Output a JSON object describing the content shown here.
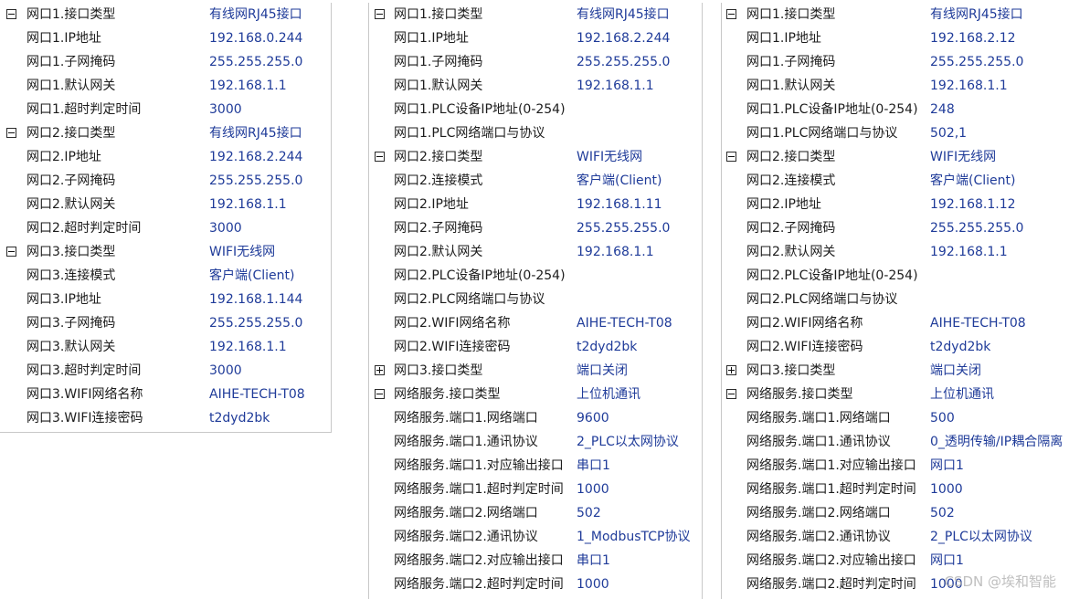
{
  "panels": [
    {
      "rows": [
        {
          "label": "网口1.接口类型",
          "value": "有线网RJ45接口",
          "toggle": "collapse"
        },
        {
          "label": "网口1.IP地址",
          "value": "192.168.0.244"
        },
        {
          "label": "网口1.子网掩码",
          "value": "255.255.255.0"
        },
        {
          "label": "网口1.默认网关",
          "value": "192.168.1.1"
        },
        {
          "label": "网口1.超时判定时间",
          "value": "3000"
        },
        {
          "label": "网口2.接口类型",
          "value": "有线网RJ45接口",
          "toggle": "collapse"
        },
        {
          "label": "网口2.IP地址",
          "value": "192.168.2.244"
        },
        {
          "label": "网口2.子网掩码",
          "value": "255.255.255.0"
        },
        {
          "label": "网口2.默认网关",
          "value": "192.168.1.1"
        },
        {
          "label": "网口2.超时判定时间",
          "value": "3000"
        },
        {
          "label": "网口3.接口类型",
          "value": "WIFI无线网",
          "toggle": "collapse"
        },
        {
          "label": "网口3.连接模式",
          "value": "客户端(Client)"
        },
        {
          "label": "网口3.IP地址",
          "value": "192.168.1.144"
        },
        {
          "label": "网口3.子网掩码",
          "value": "255.255.255.0"
        },
        {
          "label": "网口3.默认网关",
          "value": "192.168.1.1"
        },
        {
          "label": "网口3.超时判定时间",
          "value": "3000"
        },
        {
          "label": "网口3.WIFI网络名称",
          "value": "AIHE-TECH-T08"
        },
        {
          "label": "网口3.WIFI连接密码",
          "value": "t2dyd2bk"
        }
      ]
    },
    {
      "rows": [
        {
          "label": "网口1.接口类型",
          "value": "有线网RJ45接口",
          "toggle": "collapse"
        },
        {
          "label": "网口1.IP地址",
          "value": "192.168.2.244"
        },
        {
          "label": "网口1.子网掩码",
          "value": "255.255.255.0"
        },
        {
          "label": "网口1.默认网关",
          "value": "192.168.1.1"
        },
        {
          "label": "网口1.PLC设备IP地址(0-254)",
          "value": ""
        },
        {
          "label": "网口1.PLC网络端口与协议",
          "value": ""
        },
        {
          "label": "网口2.接口类型",
          "value": "WIFI无线网",
          "toggle": "collapse"
        },
        {
          "label": "网口2.连接模式",
          "value": "客户端(Client)"
        },
        {
          "label": "网口2.IP地址",
          "value": "192.168.1.11"
        },
        {
          "label": "网口2.子网掩码",
          "value": "255.255.255.0"
        },
        {
          "label": "网口2.默认网关",
          "value": "192.168.1.1"
        },
        {
          "label": "网口2.PLC设备IP地址(0-254)",
          "value": ""
        },
        {
          "label": "网口2.PLC网络端口与协议",
          "value": ""
        },
        {
          "label": "网口2.WIFI网络名称",
          "value": "AIHE-TECH-T08"
        },
        {
          "label": "网口2.WIFI连接密码",
          "value": "t2dyd2bk"
        },
        {
          "label": "网口3.接口类型",
          "value": "端口关闭",
          "toggle": "expand"
        },
        {
          "label": "网络服务.接口类型",
          "value": "上位机通讯",
          "toggle": "collapse"
        },
        {
          "label": "网络服务.端口1.网络端口",
          "value": "9600"
        },
        {
          "label": "网络服务.端口1.通讯协议",
          "value": "2_PLC以太网协议"
        },
        {
          "label": "网络服务.端口1.对应输出接口",
          "value": "串口1"
        },
        {
          "label": "网络服务.端口1.超时判定时间",
          "value": "1000"
        },
        {
          "label": "网络服务.端口2.网络端口",
          "value": "502"
        },
        {
          "label": "网络服务.端口2.通讯协议",
          "value": "1_ModbusTCP协议"
        },
        {
          "label": "网络服务.端口2.对应输出接口",
          "value": "串口1"
        },
        {
          "label": "网络服务.端口2.超时判定时间",
          "value": "1000"
        }
      ]
    },
    {
      "rows": [
        {
          "label": "网口1.接口类型",
          "value": "有线网RJ45接口",
          "toggle": "collapse"
        },
        {
          "label": "网口1.IP地址",
          "value": "192.168.2.12"
        },
        {
          "label": "网口1.子网掩码",
          "value": "255.255.255.0"
        },
        {
          "label": "网口1.默认网关",
          "value": "192.168.1.1"
        },
        {
          "label": "网口1.PLC设备IP地址(0-254)",
          "value": "248"
        },
        {
          "label": "网口1.PLC网络端口与协议",
          "value": "502,1"
        },
        {
          "label": "网口2.接口类型",
          "value": "WIFI无线网",
          "toggle": "collapse"
        },
        {
          "label": "网口2.连接模式",
          "value": "客户端(Client)"
        },
        {
          "label": "网口2.IP地址",
          "value": "192.168.1.12"
        },
        {
          "label": "网口2.子网掩码",
          "value": "255.255.255.0"
        },
        {
          "label": "网口2.默认网关",
          "value": "192.168.1.1"
        },
        {
          "label": "网口2.PLC设备IP地址(0-254)",
          "value": ""
        },
        {
          "label": "网口2.PLC网络端口与协议",
          "value": ""
        },
        {
          "label": "网口2.WIFI网络名称",
          "value": "AIHE-TECH-T08"
        },
        {
          "label": "网口2.WIFI连接密码",
          "value": "t2dyd2bk"
        },
        {
          "label": "网口3.接口类型",
          "value": "端口关闭",
          "toggle": "expand"
        },
        {
          "label": "网络服务.接口类型",
          "value": "上位机通讯",
          "toggle": "collapse"
        },
        {
          "label": "网络服务.端口1.网络端口",
          "value": "500"
        },
        {
          "label": "网络服务.端口1.通讯协议",
          "value": "0_透明传输/IP耦合隔离"
        },
        {
          "label": "网络服务.端口1.对应输出接口",
          "value": "网口1"
        },
        {
          "label": "网络服务.端口1.超时判定时间",
          "value": "1000"
        },
        {
          "label": "网络服务.端口2.网络端口",
          "value": "502"
        },
        {
          "label": "网络服务.端口2.通讯协议",
          "value": "2_PLC以太网协议"
        },
        {
          "label": "网络服务.端口2.对应输出接口",
          "value": "网口1"
        },
        {
          "label": "网络服务.端口2.超时判定时间",
          "value": "1000"
        }
      ]
    }
  ],
  "watermark": "CSDN @埃和智能"
}
